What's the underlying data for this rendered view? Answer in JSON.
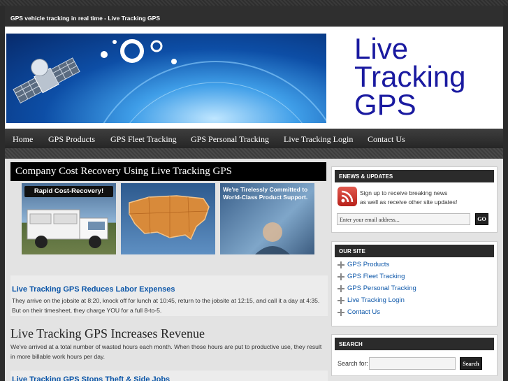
{
  "site": {
    "title": "GPS vehicle tracking in real time - Live Tracking GPS",
    "logo_lines": [
      "Live",
      "Tracking",
      "GPS"
    ]
  },
  "nav": {
    "items": [
      "Home",
      "GPS Products",
      "GPS Fleet Tracking",
      "GPS Personal Tracking",
      "Live Tracking Login",
      "Contact Us"
    ]
  },
  "feature": {
    "title": "Company Cost Recovery Using Live Tracking GPS",
    "thumbs": [
      {
        "caption": "Rapid Cost-Recovery!"
      },
      {
        "caption": ""
      },
      {
        "caption": "We're Tirelessly Committed to World-Class Product Support."
      }
    ]
  },
  "posts": [
    {
      "title": "Live Tracking GPS Reduces Labor Expenses",
      "body": "They arrive on the jobsite at 8:20, knock off for lunch at 10:45, return to the jobsite at 12:15, and call it a day at 4:35. But on their timesheet, they charge YOU for a full 8-to-5."
    },
    {
      "title": "Live Tracking GPS Increases Revenue",
      "body": "We've arrived at a total number of wasted hours each month. When those hours are put to productive use, they result in more billable work hours per day."
    },
    {
      "title": "Live Tracking GPS Stops Theft & Side Jobs",
      "body": ""
    }
  ],
  "sidebar": {
    "enews": {
      "heading": "ENEWS & UPDATES",
      "text_line1": "Sign up to receive breaking news",
      "text_line2": "as well as receive other site updates!",
      "email_placeholder": "Enter your email address...",
      "go_label": "GO"
    },
    "oursite": {
      "heading": "OUR SITE",
      "links": [
        "GPS Products",
        "GPS Fleet Tracking",
        "GPS Personal Tracking",
        "Live Tracking Login",
        "Contact Us"
      ]
    },
    "search": {
      "heading": "SEARCH",
      "label": "Search for:",
      "button": "Search",
      "value": ""
    }
  },
  "colors": {
    "link_blue": "#0a55a8",
    "logo_blue": "#1a1aa0",
    "dark": "#2b2b2b"
  }
}
